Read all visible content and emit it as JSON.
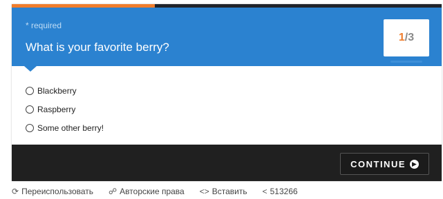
{
  "survey": {
    "required_label": "* required",
    "question": "What is your favorite berry?",
    "progress": {
      "current": "1",
      "separator": "/",
      "total": "3",
      "fraction_complete": 0.333
    },
    "options": [
      {
        "label": "Blackberry",
        "selected": false
      },
      {
        "label": "Raspberry",
        "selected": false
      },
      {
        "label": "Some other berry!",
        "selected": false
      }
    ],
    "continue_label": "CONTINUE",
    "continue_icon": "chevron-right-circle-icon"
  },
  "bottom_bar": {
    "reuse_label": "Переиспользовать",
    "copyright_label": "Авторские права",
    "embed_label": "Вставить",
    "share_count": "513266"
  },
  "colors": {
    "header_blue": "#2b82d0",
    "accent_orange": "#f07d2d",
    "footer_dark": "#202020"
  }
}
